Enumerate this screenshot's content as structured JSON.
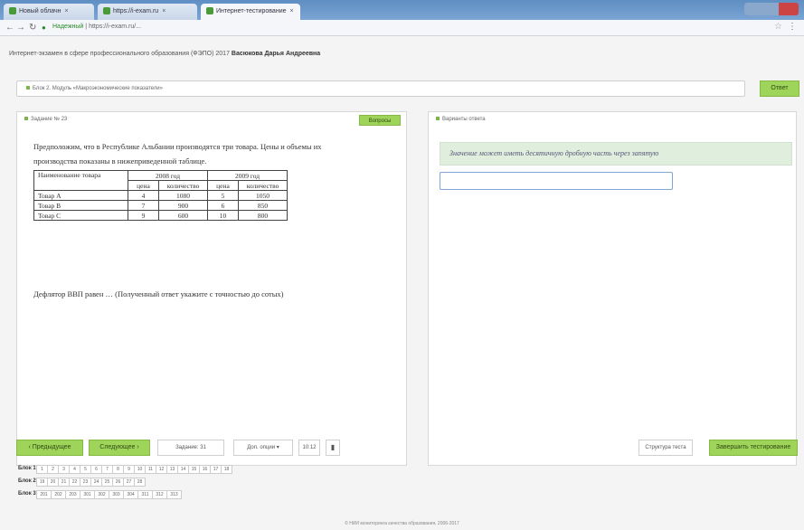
{
  "browser": {
    "tabs": [
      {
        "label": "Новый облачн"
      },
      {
        "label": "https://i-exam.ru"
      },
      {
        "label": "Интернет-тестирование"
      }
    ],
    "url_secure": "Надежный",
    "url": "https://i-exam.ru/..."
  },
  "page": {
    "info_prefix": "Интернет-экзамен в сфере профессионального образования (ФЭПО) 2017",
    "student_name": "Васюкова Дарья Андреевна",
    "block_label": "Блок 2. Модуль «Макроэкономические показатели»",
    "go_button": "Ответ",
    "task_title": "Задание № 23",
    "question_button": "Вопросы",
    "answer_title": "Варианты ответа",
    "question_text": "Предположим, что в Республике Альбании производятся три товара. Цены и объемы их производства показаны в нижеприведенной таблице.",
    "table": {
      "h_name": "Наименование товара",
      "h_2008": "2008 год",
      "h_2009": "2009 год",
      "h_price": "цена",
      "h_qty": "количество",
      "rows": [
        {
          "name": "Товар A",
          "p1": "4",
          "q1": "1080",
          "p2": "5",
          "q2": "1050"
        },
        {
          "name": "Товар B",
          "p1": "7",
          "q1": "900",
          "p2": "6",
          "q2": "850"
        },
        {
          "name": "Товар C",
          "p1": "9",
          "q1": "600",
          "p2": "10",
          "q2": "800"
        }
      ]
    },
    "deflator_text": "Дефлятор ВВП равен … (Полученный ответ укажите с точностью до сотых)",
    "hint": "Значение может иметь десятичную дробную часть через запятую",
    "answer_value": ""
  },
  "bottom": {
    "prev": "Предыдущее",
    "next": "Следующее",
    "task_counter": "Задание: 31",
    "time_label": "Доп. опции",
    "timer": "10:12",
    "structure": "Структура теста",
    "finish": "Завершить тестирование"
  },
  "blocks": [
    {
      "label": "Блок 1",
      "cells": [
        "1",
        "2",
        "3",
        "4",
        "5",
        "6",
        "7",
        "8",
        "9",
        "10",
        "11",
        "12",
        "13",
        "14",
        "15",
        "16",
        "17",
        "18"
      ]
    },
    {
      "label": "Блок 2",
      "cells": [
        "19",
        "20",
        "21",
        "22",
        "23",
        "24",
        "25",
        "26",
        "27",
        "28"
      ]
    },
    {
      "label": "Блок 3",
      "cells": [
        "201",
        "202",
        "203",
        "301",
        "302",
        "303",
        "304",
        "311",
        "312",
        "313"
      ]
    }
  ],
  "footer": "© НИИ мониторинга качества образования, 2006-2017",
  "colors": {
    "accent": "#9fd45a",
    "hint_bg": "#dfeedd",
    "input_border": "#7ea6d8"
  }
}
